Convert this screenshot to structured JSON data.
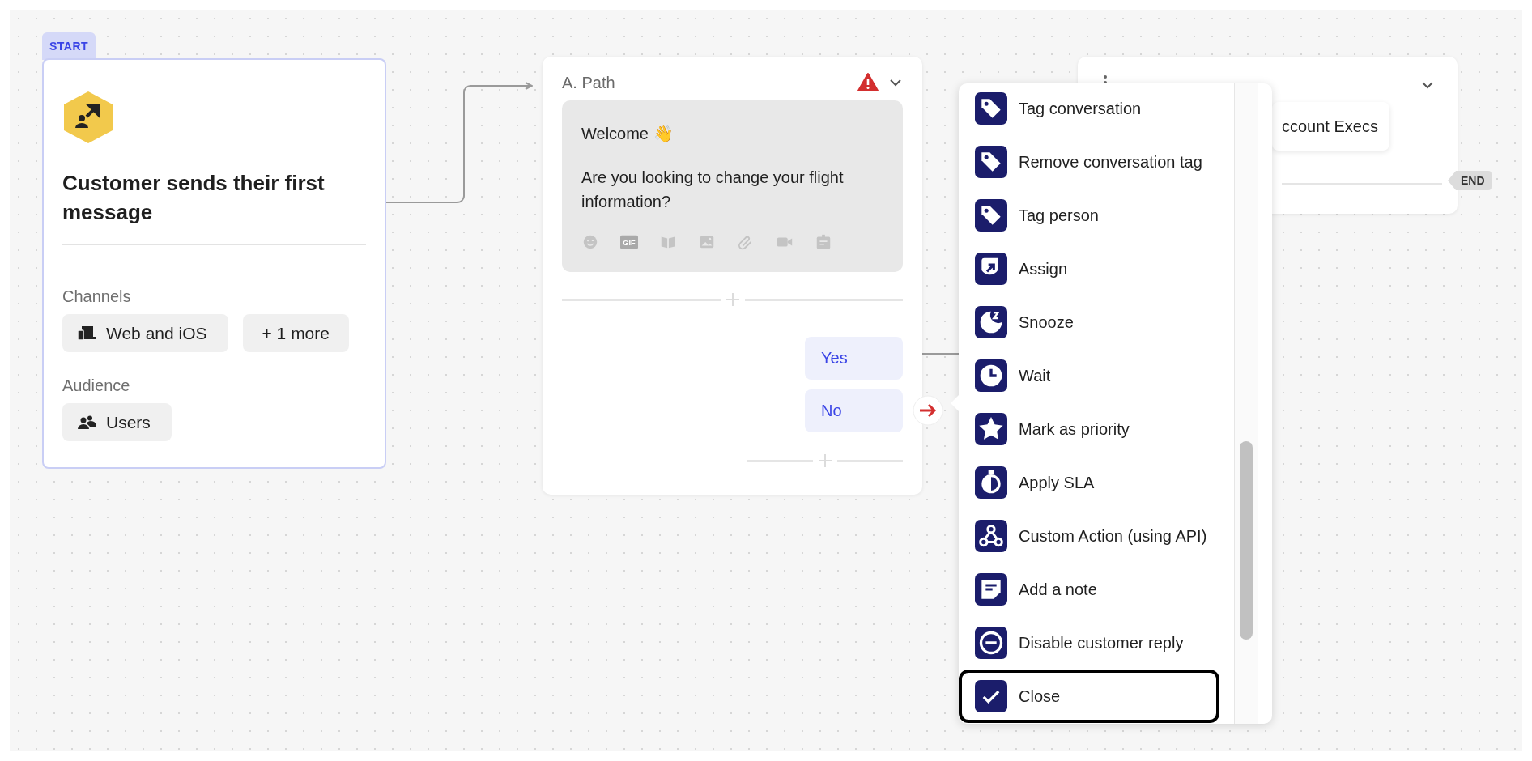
{
  "start_node": {
    "badge": "START",
    "title": "Customer sends their first message",
    "sections": [
      {
        "label": "Channels",
        "chips": [
          {
            "kind": "channel",
            "text": "Web and iOS"
          },
          {
            "kind": "more",
            "text": "+ 1 more"
          }
        ]
      },
      {
        "label": "Audience",
        "chips": [
          {
            "kind": "audience",
            "text": "Users"
          }
        ]
      }
    ]
  },
  "path_a": {
    "title": "A. Path",
    "warning": true,
    "message": {
      "paragraphs": [
        "Welcome 👋",
        "Are you looking to change your flight information?"
      ],
      "gif_label": "GIF"
    },
    "replies": [
      {
        "label": "Yes",
        "error": false
      },
      {
        "label": "No",
        "error": true
      }
    ]
  },
  "path_b": {
    "chip": "ccount Execs",
    "end_badge": "END"
  },
  "action_menu": {
    "items": [
      {
        "kind": "tag",
        "label": "Tag conversation",
        "selected": false
      },
      {
        "kind": "tag",
        "label": "Remove conversation tag",
        "selected": false
      },
      {
        "kind": "tag",
        "label": "Tag person",
        "selected": false
      },
      {
        "kind": "assign",
        "label": "Assign",
        "selected": false
      },
      {
        "kind": "snooze",
        "label": "Snooze",
        "selected": false
      },
      {
        "kind": "wait",
        "label": "Wait",
        "selected": false
      },
      {
        "kind": "priority",
        "label": "Mark as priority",
        "selected": false
      },
      {
        "kind": "sla",
        "label": "Apply SLA",
        "selected": false
      },
      {
        "kind": "webhook",
        "label": "Custom Action (using API)",
        "selected": false
      },
      {
        "kind": "note",
        "label": "Add a note",
        "selected": false
      },
      {
        "kind": "disable",
        "label": "Disable customer reply",
        "selected": false
      },
      {
        "kind": "close",
        "label": "Close",
        "selected": true
      }
    ]
  }
}
